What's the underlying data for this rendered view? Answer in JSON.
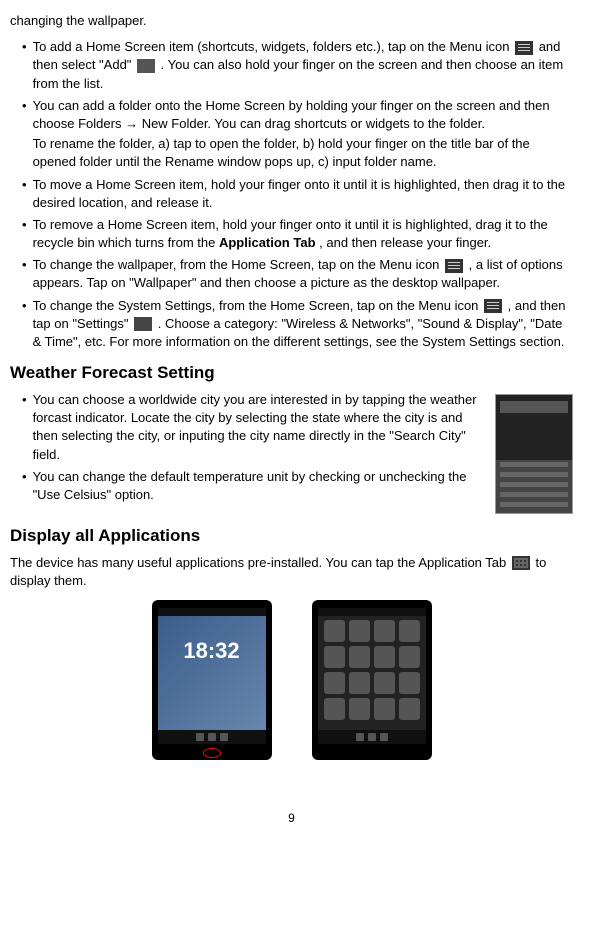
{
  "top_fragment": "changing the wallpaper.",
  "bullets": {
    "b1_pre": "To add a Home Screen item (shortcuts, widgets, folders etc.), tap on the Menu icon ",
    "b1_mid": " and then select \"Add\"  ",
    "b1_post": ". You can also hold your finger on the screen and then choose an item from the list.",
    "b2_pre": "You can add a folder onto the Home Screen by holding your finger on the screen and then choose Folders ",
    "b2_arrow": "→",
    "b2_post": " New Folder. You can drag shortcuts or widgets to the folder.",
    "b2_para2": "To rename the folder, a) tap to open the folder, b) hold your finger on the title bar of the opened folder until the Rename window pops up, c) input folder name.",
    "b3": "To move a Home Screen item, hold your finger onto it until it is highlighted, then drag it to the desired location, and release it.",
    "b4_pre": "To remove a Home Screen item, hold your finger onto it until it is highlighted, drag it to the recycle bin which turns from the ",
    "b4_bold": "Application Tab",
    "b4_post": ", and then release your finger.",
    "b5_pre": "To change the wallpaper, from the Home Screen, tap on the Menu icon ",
    "b5_post": ", a list of options appears. Tap on \"Wallpaper\" and then choose a picture as the desktop wallpaper.",
    "b6_pre": "To change the System Settings, from the Home Screen, tap on the Menu icon ",
    "b6_mid": ", and then tap on \"Settings\"  ",
    "b6_post": ". Choose a category: \"Wireless & Networks\", \"Sound & Display\", \"Date & Time\", etc. For more information on the different settings, see the System Settings section."
  },
  "weather": {
    "heading": "Weather Forecast Setting",
    "b1": "You can choose a worldwide city you are interested in by tapping the weather forcast indicator. Locate the city by selecting the state where the city is and then selecting the city, or inputing the city name directly in the \"Search City\" field.",
    "b2": "You can change the default temperature unit by checking or unchecking the \"Use Celsius\" option."
  },
  "display_apps": {
    "heading": "Display all Applications",
    "para_pre": "The device has many useful applications pre-installed. You can tap the Application Tab ",
    "para_post": " to display them."
  },
  "clock": "18:32",
  "page_number": "9"
}
